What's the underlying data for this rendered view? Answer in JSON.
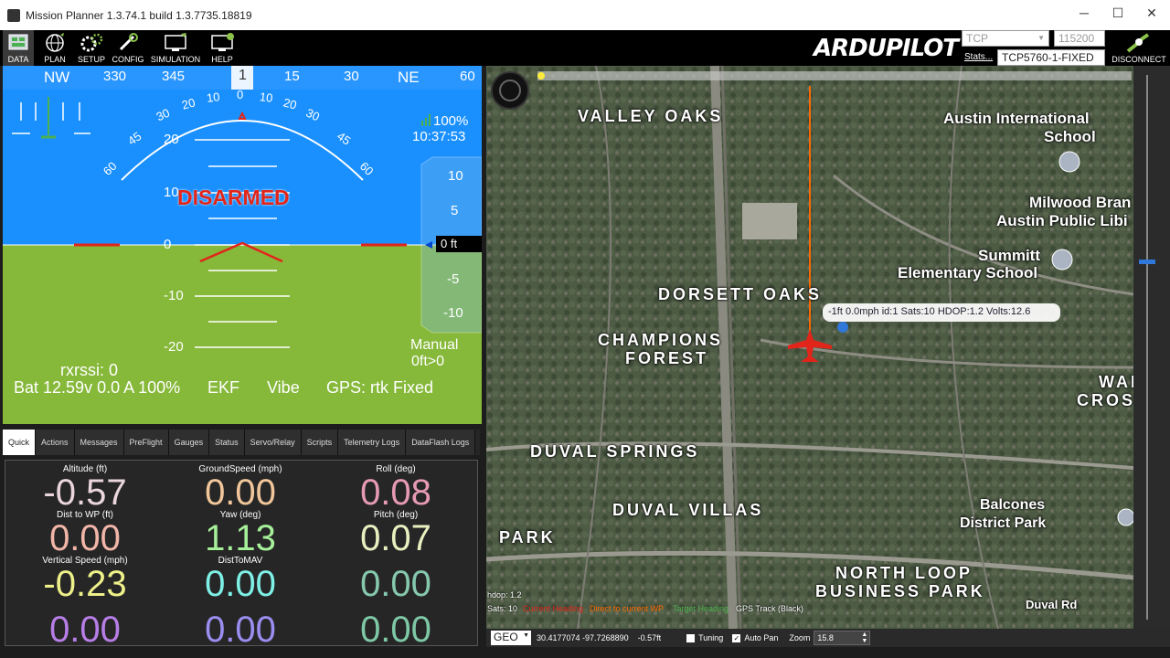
{
  "window": {
    "title": "Mission Planner 1.3.74.1 build 1.3.7735.18819",
    "min": "─",
    "max": "☐",
    "close": "✕"
  },
  "toolbar": {
    "buttons": [
      {
        "label": "DATA",
        "icon": "data-icon"
      },
      {
        "label": "PLAN",
        "icon": "globe-icon"
      },
      {
        "label": "SETUP",
        "icon": "gears-icon"
      },
      {
        "label": "CONFIG",
        "icon": "wrench-icon"
      },
      {
        "label": "SIMULATION",
        "icon": "simulation-icon"
      },
      {
        "label": "HELP",
        "icon": "help-icon"
      }
    ],
    "logo": "ARDUPILOT",
    "conn_type": "TCP",
    "baud": "115200",
    "stats": "Stats...",
    "port": "TCP5760-1-FIXED",
    "disconnect": "DISCONNECT"
  },
  "hud": {
    "heading_labels": [
      "NW",
      "330",
      "345",
      "1",
      "15",
      "30",
      "NE",
      "60"
    ],
    "roll_marks": [
      "60",
      "45",
      "30",
      "20",
      "10",
      "0",
      "10",
      "20",
      "30",
      "45",
      "60"
    ],
    "pitch_labels": [
      "20",
      "10",
      "0",
      "-10",
      "-20"
    ],
    "status": "DISARMED",
    "battery_pct": "100%",
    "time": "10:37:53",
    "alt_ticks": [
      "10",
      "5",
      "0 ft",
      "-5",
      "-10"
    ],
    "mode": "Manual",
    "wp": "0ft>0",
    "rxrssi": "rxrssi: 0",
    "bat": "Bat 12.59v 0.0 A 100%",
    "ekf": "EKF",
    "vibe": "Vibe",
    "gps": "GPS: rtk Fixed",
    "colors": {
      "sky": "#0c89ff",
      "ground": "#86b83a",
      "disarmed": "#e1251b"
    }
  },
  "tabs": [
    "Quick",
    "Actions",
    "Messages",
    "PreFlight",
    "Gauges",
    "Status",
    "Servo/Relay",
    "Scripts",
    "Telemetry Logs",
    "DataFlash Logs"
  ],
  "quick": [
    {
      "label": "Altitude (ft)",
      "value": "-0.57",
      "color": "#ead6dc"
    },
    {
      "label": "GroundSpeed (mph)",
      "value": "0.00",
      "color": "#f0c69a"
    },
    {
      "label": "Roll (deg)",
      "value": "0.08",
      "color": "#e69ab4"
    },
    {
      "label": "Dist to WP (ft)",
      "value": "0.00",
      "color": "#f2b6a8"
    },
    {
      "label": "Yaw (deg)",
      "value": "1.13",
      "color": "#a6f09a"
    },
    {
      "label": "Pitch (deg)",
      "value": "0.07",
      "color": "#e8f0c0"
    },
    {
      "label": "Vertical Speed (mph)",
      "value": "-0.23",
      "color": "#eef08a"
    },
    {
      "label": "DistToMAV",
      "value": "0.00",
      "color": "#7ef0e6"
    },
    {
      "label": "",
      "value": "0.00",
      "color": "#86c8ae"
    },
    {
      "label": "",
      "value": "0.00",
      "color": "#b67ee6"
    },
    {
      "label": "",
      "value": "0.00",
      "color": "#9a8ef0"
    },
    {
      "label": "",
      "value": "0.00",
      "color": "#7ec8a6"
    }
  ],
  "map": {
    "labels": [
      "VALLEY OAKS",
      "Austin International",
      "School",
      "Milwood Bran",
      "Austin Public Libi",
      "Summitt",
      "Elementary School",
      "DORSETT OAKS",
      "CHAMPIONS",
      "FOREST",
      "WAI",
      "CROS",
      "DUVAL SPRINGS",
      "DUVAL VILLAS",
      "PARK",
      "Balcones",
      "District Park",
      "NORTH LOOP",
      "BUSINESS PARK",
      "Duval Rd"
    ],
    "tooltip": "-1ft 0.0mph id:1 Sats:10 HDOP:1.2 Volts:12.6",
    "hdop": "hdop: 1.2",
    "sats": "Sats: 10",
    "legend": [
      "Current Heading",
      "Direct to current WP",
      "Target Heading",
      "GPS Track (Black)"
    ],
    "coord_mode": "GEO",
    "coords": "30.4177074 -97.7268890",
    "alt": "-0.57ft",
    "tuning": "Tuning",
    "autopan": "Auto Pan",
    "zoom_label": "Zoom",
    "zoom": "15.8"
  }
}
